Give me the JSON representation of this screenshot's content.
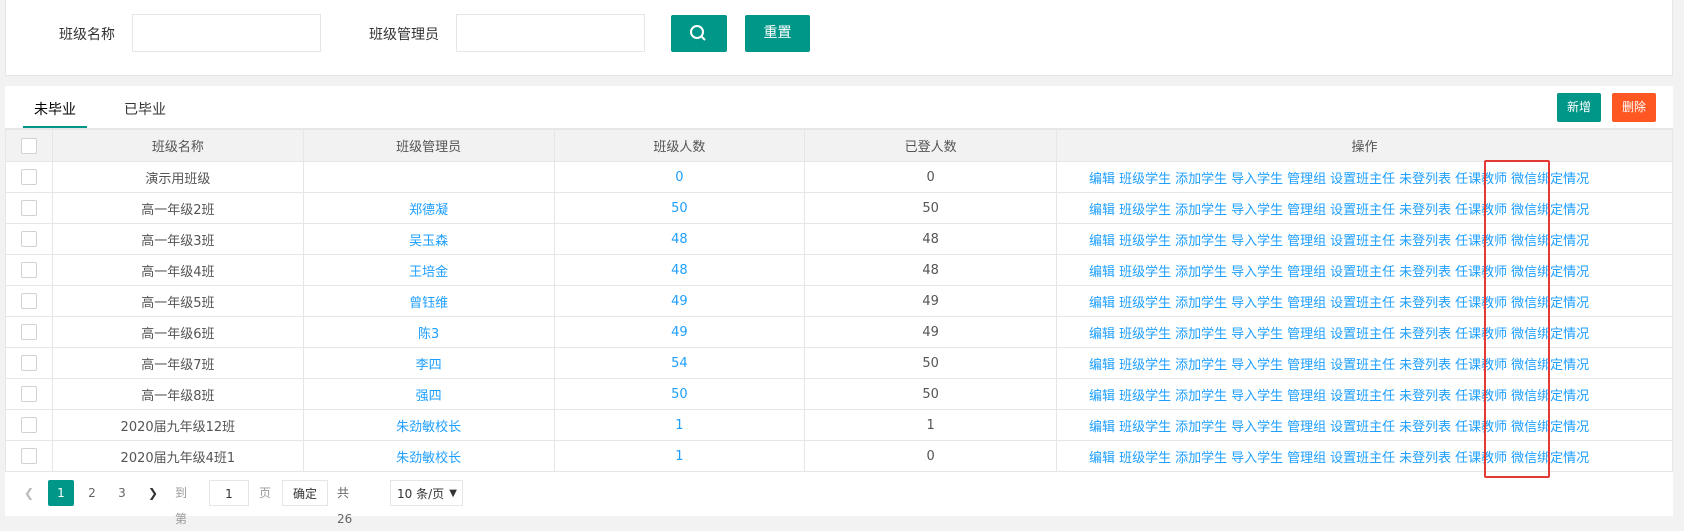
{
  "filter": {
    "class_name_label": "班级名称",
    "class_name_value": "",
    "manager_label": "班级管理员",
    "manager_value": "",
    "reset_label": "重置"
  },
  "tabs": [
    {
      "label": "未毕业",
      "active": true
    },
    {
      "label": "已毕业",
      "active": false
    }
  ],
  "toolbar": {
    "add_label": "新增",
    "delete_label": "删除"
  },
  "table": {
    "headers": [
      "班级名称",
      "班级管理员",
      "班级人数",
      "已登人数",
      "操作"
    ],
    "actions": [
      "编辑",
      "班级学生",
      "添加学生",
      "导入学生",
      "管理组",
      "设置班主任",
      "未登列表",
      "任课教师",
      "微信绑定情况"
    ],
    "rows": [
      {
        "name": "演示用班级",
        "manager": "",
        "count": "0",
        "logged": "0"
      },
      {
        "name": "高一年级2班",
        "manager": "郑德凝",
        "count": "50",
        "logged": "50"
      },
      {
        "name": "高一年级3班",
        "manager": "吴玉森",
        "count": "48",
        "logged": "48"
      },
      {
        "name": "高一年级4班",
        "manager": "王培金",
        "count": "48",
        "logged": "48"
      },
      {
        "name": "高一年级5班",
        "manager": "曾钰维",
        "count": "49",
        "logged": "49"
      },
      {
        "name": "高一年级6班",
        "manager": "陈3",
        "count": "49",
        "logged": "49"
      },
      {
        "name": "高一年级7班",
        "manager": "李四",
        "count": "54",
        "logged": "50"
      },
      {
        "name": "高一年级8班",
        "manager": "强四",
        "count": "50",
        "logged": "50"
      },
      {
        "name": "2020届九年级12班",
        "manager": "朱劲敏校长",
        "count": "1",
        "logged": "1"
      },
      {
        "name": "2020届九年级4班1",
        "manager": "朱劲敏校长",
        "count": "1",
        "logged": "0"
      }
    ]
  },
  "pager": {
    "pages": [
      "1",
      "2",
      "3"
    ],
    "current": "1",
    "goto_label": "到第",
    "page_input": "1",
    "page_unit": "页",
    "confirm_label": "确定",
    "total_text": "共 26 条",
    "per_page": "10 条/页"
  },
  "icons": {
    "search": "search-icon",
    "prev": "chevron-left-icon",
    "next": "chevron-right-icon",
    "dropdown": "chevron-down-icon"
  },
  "colors": {
    "primary": "#009688",
    "danger": "#ff5722",
    "link": "#1e9fff",
    "highlight": "#e53935"
  }
}
